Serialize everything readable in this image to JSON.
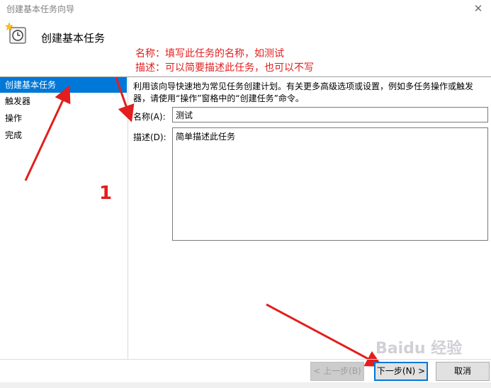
{
  "window": {
    "title": "创建基本任务向导",
    "close_glyph": "✕"
  },
  "header": {
    "title": "创建基本任务"
  },
  "annotations": {
    "line1": "名称：填写此任务的名称，如测试",
    "line2": "描述：可以简要描述此任务，也可以不写",
    "number": "1"
  },
  "steps": [
    {
      "label": "创建基本任务",
      "active": true
    },
    {
      "label": "触发器",
      "active": false
    },
    {
      "label": "操作",
      "active": false
    },
    {
      "label": "完成",
      "active": false
    }
  ],
  "main": {
    "description": "利用该向导快速地为常见任务创建计划。有关更多高级选项或设置，例如多任务操作或触发器，请使用“操作”窗格中的“创建任务”命令。",
    "name_label": "名称(A):",
    "name_value": "测试",
    "desc_label": "描述(D):",
    "desc_value": "简单描述此任务"
  },
  "buttons": {
    "back": "< 上一步(B)",
    "next": "下一步(N) >",
    "cancel": "取消"
  },
  "watermark": "Baidu 经验",
  "colors": {
    "accent": "#0078d7",
    "annotation": "#e21e1e"
  }
}
